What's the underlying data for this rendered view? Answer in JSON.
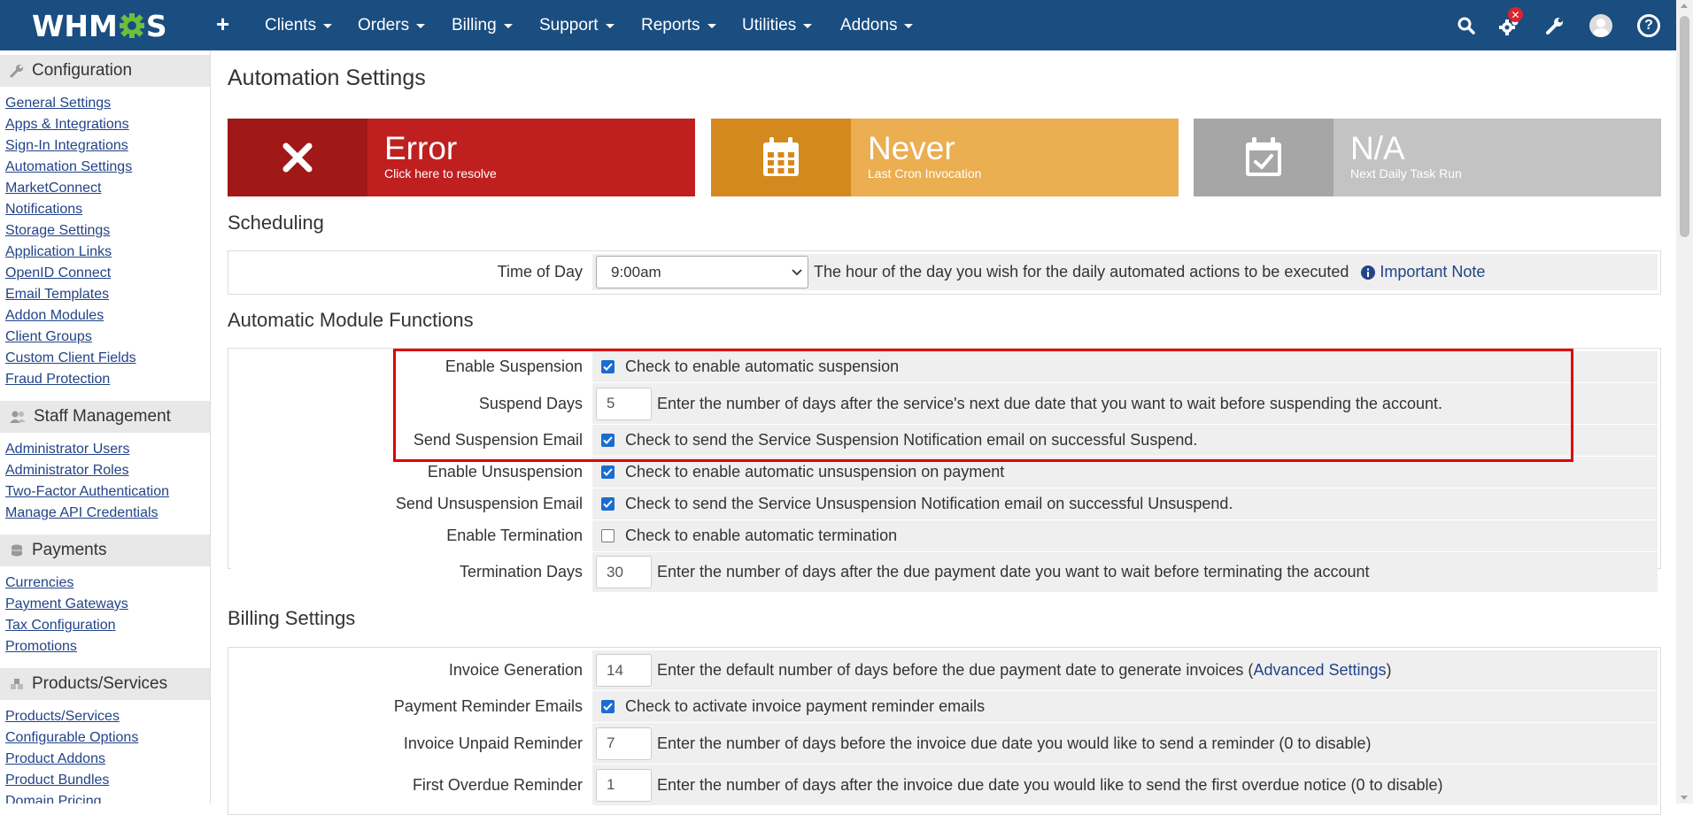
{
  "topbar": {
    "logo": "WHMCS",
    "nav": [
      "Clients",
      "Orders",
      "Billing",
      "Support",
      "Reports",
      "Utilities",
      "Addons"
    ],
    "icons": [
      "search-icon",
      "gear-icon",
      "wrench-icon",
      "avatar",
      "help-icon"
    ],
    "colors": {
      "bar": "#1a4d80"
    }
  },
  "sidebar": {
    "configuration": {
      "title": "Configuration",
      "links": [
        "General Settings",
        "Apps & Integrations",
        "Sign-In Integrations",
        "Automation Settings",
        "MarketConnect",
        "Notifications",
        "Storage Settings",
        "Application Links",
        "OpenID Connect",
        "Email Templates",
        "Addon Modules",
        "Client Groups",
        "Custom Client Fields",
        "Fraud Protection"
      ]
    },
    "staff": {
      "title": "Staff Management",
      "links": [
        "Administrator Users",
        "Administrator Roles",
        "Two-Factor Authentication",
        "Manage API Credentials"
      ]
    },
    "payments": {
      "title": "Payments",
      "links": [
        "Currencies",
        "Payment Gateways",
        "Tax Configuration",
        "Promotions"
      ]
    },
    "products": {
      "title": "Products/Services",
      "links": [
        "Products/Services",
        "Configurable Options",
        "Product Addons",
        "Product Bundles",
        "Domain Pricing"
      ]
    }
  },
  "main": {
    "title": "Automation Settings",
    "widgets": [
      {
        "big": "Error",
        "small": "Click here to resolve",
        "icon": "close-icon",
        "color_dark": "#a01818",
        "color": "#c01f1f"
      },
      {
        "big": "Never",
        "small": "Last Cron Invocation",
        "icon": "calendar-icon",
        "color_dark": "#d4891e",
        "color": "#ebae50"
      },
      {
        "big": "N/A",
        "small": "Next Daily Task Run",
        "icon": "calendar-check-icon",
        "color_dark": "#a6a6a6",
        "color": "#c3c3c3"
      }
    ],
    "scheduling": {
      "title": "Scheduling",
      "time_label": "Time of Day",
      "time_value": "9:00am",
      "time_desc": "The hour of the day you wish for the daily automated actions to be executed",
      "note_link": "Important Note"
    },
    "module": {
      "title": "Automatic Module Functions",
      "rows": [
        {
          "label": "Enable Suspension",
          "checked": true,
          "desc": "Check to enable automatic suspension"
        },
        {
          "label": "Suspend Days",
          "value": "5",
          "desc": "Enter the number of days after the service's next due date that you want to wait before suspending the account."
        },
        {
          "label": "Send Suspension Email",
          "checked": true,
          "desc": "Check to send the Service Suspension Notification email on successful Suspend."
        },
        {
          "label": "Enable Unsuspension",
          "checked": true,
          "desc": "Check to enable automatic unsuspension on payment"
        },
        {
          "label": "Send Unsuspension Email",
          "checked": true,
          "desc": "Check to send the Service Unsuspension Notification email on successful Unsuspend."
        },
        {
          "label": "Enable Termination",
          "checked": false,
          "desc": "Check to enable automatic termination"
        },
        {
          "label": "Termination Days",
          "value": "30",
          "desc": "Enter the number of days after the due payment date you want to wait before terminating the account"
        }
      ]
    },
    "billing": {
      "title": "Billing Settings",
      "invoice_gen": {
        "label": "Invoice Generation",
        "value": "14",
        "desc": "Enter the default number of days before the due payment date to generate invoices (",
        "link": "Advanced Settings",
        "desc_end": ")"
      },
      "reminder": {
        "label": "Payment Reminder Emails",
        "checked": true,
        "desc": "Check to activate invoice payment reminder emails"
      },
      "unpaid": {
        "label": "Invoice Unpaid Reminder",
        "value": "7",
        "desc": "Enter the number of days before the invoice due date you would like to send a reminder (0 to disable)"
      },
      "overdue": {
        "label": "First Overdue Reminder",
        "value": "1",
        "desc": "Enter the number of days after the invoice due date you would like to send the first overdue notice (0 to disable)"
      }
    }
  }
}
